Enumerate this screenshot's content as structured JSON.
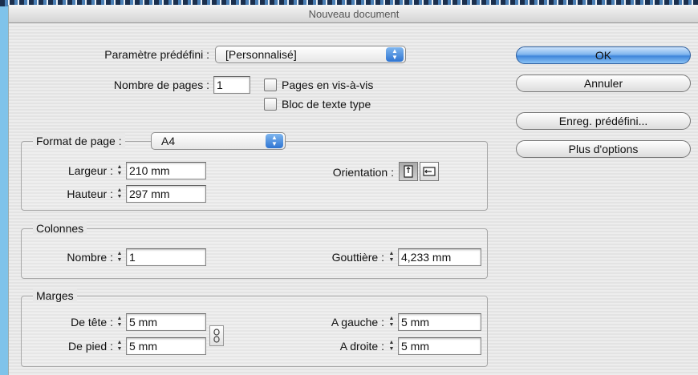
{
  "window": {
    "title": "Nouveau document"
  },
  "preset": {
    "label": "Paramètre prédéfini :",
    "value": "[Personnalisé]"
  },
  "pages": {
    "label": "Nombre de pages :",
    "value": "1",
    "facing_label": "Pages en vis-à-vis",
    "master_text_label": "Bloc de texte type"
  },
  "buttons": {
    "ok": "OK",
    "cancel": "Annuler",
    "save_preset": "Enreg. prédéfini...",
    "more_options": "Plus d'options"
  },
  "page_format": {
    "label": "Format de page :",
    "value": "A4",
    "width_label": "Largeur :",
    "width_value": "210 mm",
    "height_label": "Hauteur :",
    "height_value": "297 mm",
    "orientation_label": "Orientation :"
  },
  "columns": {
    "title": "Colonnes",
    "number_label": "Nombre :",
    "number_value": "1",
    "gutter_label": "Gouttière :",
    "gutter_value": "4,233 mm"
  },
  "margins": {
    "title": "Marges",
    "top_label": "De tête :",
    "top_value": "5 mm",
    "bottom_label": "De pied :",
    "bottom_value": "5 mm",
    "left_label": "A gauche :",
    "left_value": "5 mm",
    "right_label": "A droite :",
    "right_value": "5 mm"
  },
  "icons": {
    "stepper": "stepper-arrows-icon",
    "popup": "popup-arrows-icon",
    "portrait": "portrait-page-icon",
    "landscape": "landscape-page-icon",
    "chain": "chain-link-icon"
  },
  "colors": {
    "accent": "#3f86db",
    "background": "#7fc3ea"
  }
}
